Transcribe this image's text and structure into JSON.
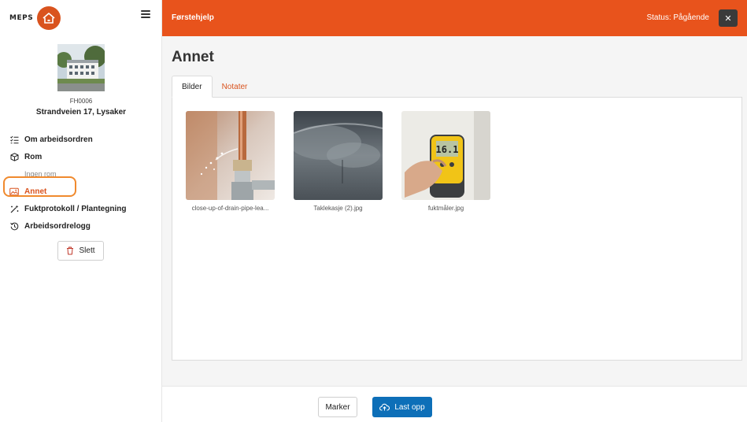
{
  "brand": {
    "name": "MEPS",
    "accent": "#d9531e"
  },
  "property": {
    "id": "FH0006",
    "address": "Strandveien 17, Lysaker"
  },
  "nav": {
    "items": [
      {
        "label": "Om arbeidsordren",
        "icon": "list-check-icon"
      },
      {
        "label": "Rom",
        "icon": "cube-icon"
      },
      {
        "label": "Annet",
        "icon": "image-icon",
        "active": true
      },
      {
        "label": "Fuktprotokoll / Plantegning",
        "icon": "magic-wand-icon"
      },
      {
        "label": "Arbeidsordrelogg",
        "icon": "history-icon"
      }
    ],
    "rom_empty": "Ingen rom"
  },
  "delete_label": "Slett",
  "header": {
    "title": "Førstehjelp",
    "status": "Status: Pågående",
    "close_icon": "close-icon",
    "bg": "#e8531c"
  },
  "page": {
    "title": "Annet"
  },
  "tabs": [
    {
      "label": "Bilder",
      "active": true
    },
    {
      "label": "Notater",
      "active": false
    }
  ],
  "gallery": [
    {
      "filename": "close-up-of-drain-pipe-lea..."
    },
    {
      "filename": "Taklekasje (2).jpg"
    },
    {
      "filename": "fuktmåler.jpg"
    }
  ],
  "footer": {
    "mark_label": "Marker",
    "upload_label": "Last opp",
    "upload_color": "#0d6fb8"
  }
}
